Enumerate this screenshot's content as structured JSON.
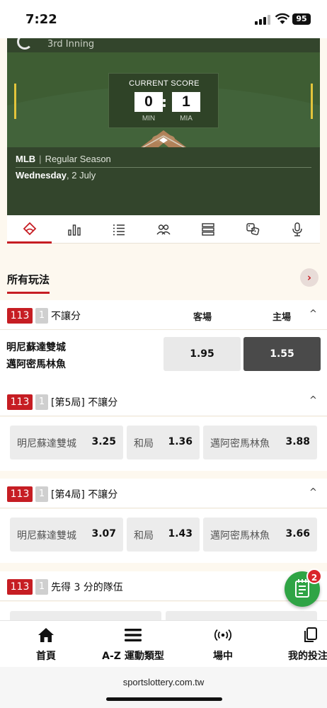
{
  "status_bar": {
    "time": "7:22",
    "battery": "95"
  },
  "hero": {
    "inning": "3rd Inning",
    "score_label": "CURRENT SCORE",
    "away_score": "0",
    "home_score": "1",
    "separator": ":",
    "away_abbr": "MIN",
    "home_abbr": "MIA",
    "league": "MLB",
    "league_sep": "|",
    "season": "Regular Season",
    "weekday": "Wednesday",
    "date": ", 2 July"
  },
  "tabs": [
    {
      "icon": "baseball-diamond-icon",
      "active": true
    },
    {
      "icon": "bar-chart-icon"
    },
    {
      "icon": "list-icon"
    },
    {
      "icon": "players-icon"
    },
    {
      "icon": "lineup-icon"
    },
    {
      "icon": "dice-icon"
    },
    {
      "icon": "microphone-icon"
    }
  ],
  "section": {
    "title": "所有玩法",
    "arrow": "›"
  },
  "markets": [
    {
      "code": "113",
      "num": "1",
      "title": "不讓分",
      "col_away": "客場",
      "col_home": "主場",
      "chevron": "^",
      "teams": [
        "明尼蘇達雙城",
        "邁阿密馬林魚"
      ],
      "odds": [
        "1.95",
        "1.55"
      ]
    },
    {
      "code": "113",
      "num": "1",
      "title": "[第5局] 不讓分",
      "chevron": "^",
      "options": [
        {
          "name": "明尼蘇達雙城",
          "value": "3.25"
        },
        {
          "name": "和局",
          "value": "1.36"
        },
        {
          "name": "邁阿密馬林魚",
          "value": "3.88"
        }
      ]
    },
    {
      "code": "113",
      "num": "1",
      "title": "[第4局] 不讓分",
      "chevron": "^",
      "options": [
        {
          "name": "明尼蘇達雙城",
          "value": "3.07"
        },
        {
          "name": "和局",
          "value": "1.43"
        },
        {
          "name": "邁阿密馬林魚",
          "value": "3.66"
        }
      ]
    },
    {
      "code": "113",
      "num": "1",
      "title": "先得 3 分的隊伍"
    }
  ],
  "fab": {
    "badge": "2",
    "icon": "bet-slip-icon"
  },
  "bottom_nav": [
    {
      "label": "首頁",
      "icon": "home-icon"
    },
    {
      "label": "A-Z 運動類型",
      "icon": "menu-icon"
    },
    {
      "label": "場中",
      "icon": "live-icon"
    },
    {
      "label": "我的投注",
      "icon": "my-bets-icon"
    }
  ],
  "browser": {
    "url": "sportslottery.com.tw"
  },
  "colors": {
    "accent": "#c61d23",
    "field": "#3c5a32",
    "fab": "#2fa445"
  }
}
